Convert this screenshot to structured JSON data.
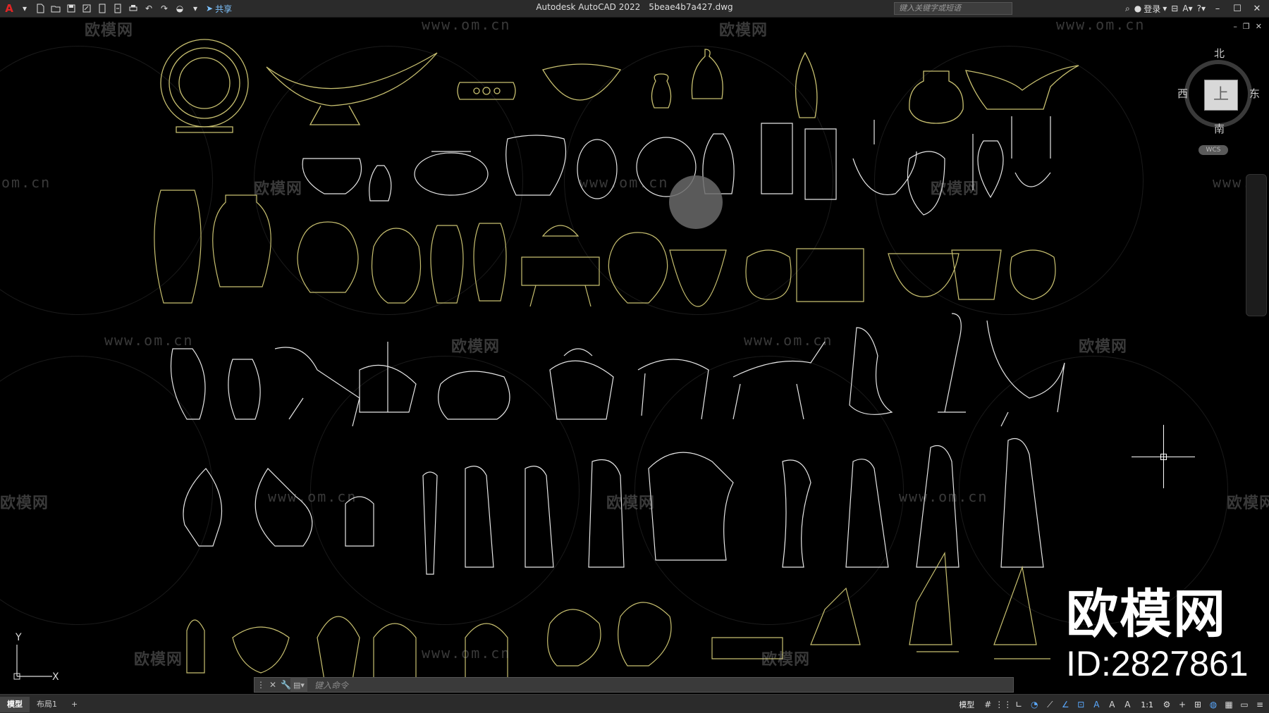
{
  "titlebar": {
    "app": "Autodesk AutoCAD 2022",
    "file": "5beae4b7a427.dwg",
    "share_label": "共享",
    "search_placeholder": "键入关键字或短语",
    "login_label": "登录"
  },
  "watermarks": {
    "logo_text": "欧模网",
    "url_text": "www.om.cn",
    "url_partial_left": "om.cn",
    "url_partial_right": "www."
  },
  "viewcube": {
    "north": "北",
    "south": "南",
    "east": "东",
    "west": "西",
    "face": "上",
    "wcs": "WCS"
  },
  "ucs": {
    "x": "X",
    "y": "Y"
  },
  "brand": {
    "name": "欧模网",
    "id": "ID:2827861"
  },
  "commandline": {
    "placeholder": "键入命令"
  },
  "statusbar": {
    "tabs": [
      "模型",
      "布局1"
    ],
    "model_label": "模型",
    "scale": "1:1"
  },
  "colors": {
    "canvas": "#000000",
    "linework_yellow": "#c8c070",
    "linework_white": "#e6e6e6",
    "toolbar_bg": "#2b2b2b",
    "accent": "#5aa9ff"
  }
}
